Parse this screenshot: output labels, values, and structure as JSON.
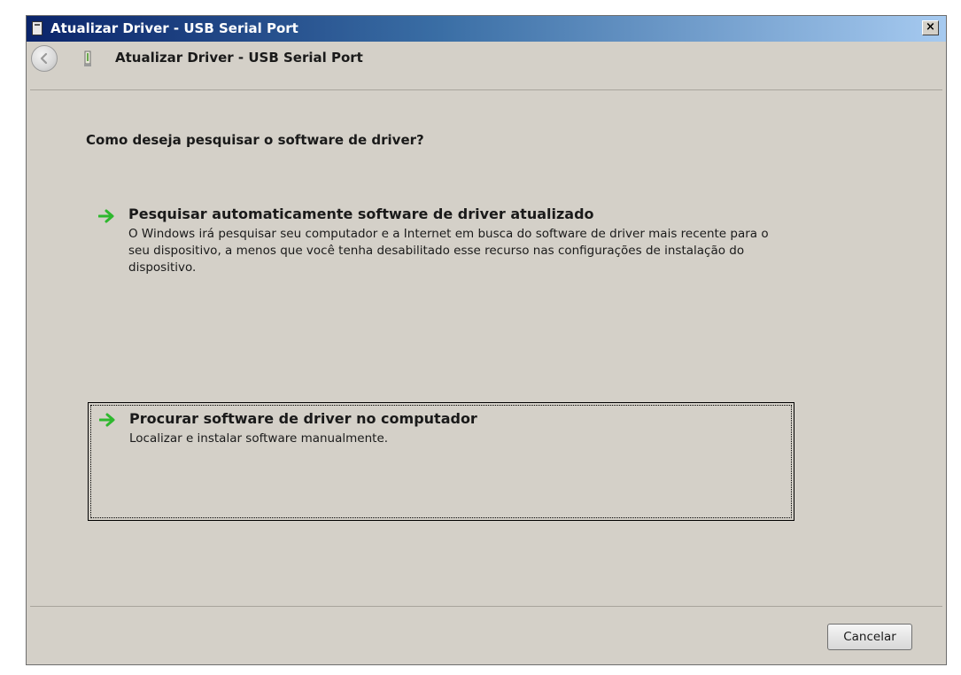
{
  "window": {
    "title": "Atualizar Driver -  USB Serial Port",
    "close_label": "×"
  },
  "nav": {
    "title": "Atualizar Driver -  USB Serial Port"
  },
  "main": {
    "question": "Como deseja pesquisar o software de driver?",
    "options": [
      {
        "title": "Pesquisar automaticamente software de driver atualizado",
        "description": "O Windows irá pesquisar seu computador e a Internet em busca do software de driver mais recente para o seu dispositivo, a menos que você tenha desabilitado esse recurso nas configurações de instalação do dispositivo."
      },
      {
        "title": "Procurar software de driver no computador",
        "description": "Localizar e instalar software manualmente."
      }
    ]
  },
  "footer": {
    "cancel_label": "Cancelar"
  },
  "icons": {
    "arrow": "green-arrow-icon",
    "back": "back-arrow-icon",
    "device": "usb-device-icon",
    "window": "window-icon"
  },
  "colors": {
    "arrow": "#2eb82e",
    "dialog_bg": "#d4d0c8"
  }
}
